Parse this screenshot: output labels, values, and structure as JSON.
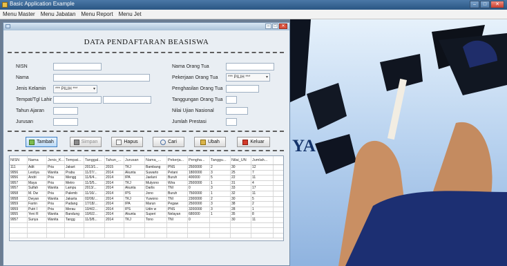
{
  "window": {
    "title": "Basic Application Example"
  },
  "menu": [
    "Menu Master",
    "Menu Jabatan",
    "Menu Report",
    "Menu Jet"
  ],
  "page": {
    "title": "DATA PENDAFTARAN BEASISWA"
  },
  "form": {
    "nisn_label": "NISN",
    "nama_label": "Nama",
    "jk_label": "Jenis Kelamin",
    "jk_value": "*** PILIH ***",
    "ttl_label": "Tempat/Tgl Lahir",
    "tahun_label": "Tahun Ajaran",
    "jurusan_label": "Jurusan",
    "nama_ortu_label": "Nama Orang Tua",
    "pekerjaan_label": "Pekerjaan Orang Tua",
    "pekerjaan_value": "*** PILIH ***",
    "penghasilan_label": "Penghasilan Orang Tua",
    "tanggungan_label": "Tanggungan Orang Tua",
    "nilai_label": "Nilai Ujian Nasional",
    "prestasi_label": "Jumlah Prestasi"
  },
  "buttons": {
    "tambah": "Tambah",
    "simpan": "Simpan",
    "hapus": "Hapus",
    "cari": "Cari",
    "ubah": "Ubah",
    "keluar": "Keluar"
  },
  "table": {
    "headers": [
      "NISN",
      "Nama",
      "Jenis_K...",
      "Tempat...",
      "Tanggal...",
      "Tahun_...",
      "Jurusan",
      "Nama_...",
      "Pekerja...",
      "Pengha...",
      "Tanggu...",
      "Nilai_UN",
      "Jumlah..."
    ],
    "rows": [
      [
        "111",
        "Adit",
        "Pria",
        "Jakart",
        "2013/1...",
        "2015",
        "TKJ",
        "Bambang",
        "PNS",
        "2500000",
        "2",
        "30",
        "12"
      ],
      [
        "9956",
        "Lestiya",
        "Wanita",
        "Prabu",
        "11/27/...",
        "2014",
        "Akunta",
        "Suwarto",
        "Petani",
        "1800000",
        "3",
        "25",
        "7"
      ],
      [
        "9956",
        "Andri",
        "Pria",
        "Mengg",
        "11/6/4...",
        "2014",
        "IPA",
        "Jaelani",
        "Buruh",
        "400000",
        "5",
        "22",
        "11"
      ],
      [
        "9957",
        "Maya",
        "Pria",
        "Metro",
        "11/3/5...",
        "2014",
        "TKJ",
        "Mulyono",
        "Wira",
        "2500000",
        "1",
        "31",
        "4"
      ],
      [
        "9957",
        "Sulfah",
        "Wanita",
        "Lampu",
        "2013/...",
        "2014",
        "Akunta",
        "Darlis",
        "TNI",
        "0",
        "3",
        "33",
        "17"
      ],
      [
        "9958",
        "M. Dw",
        "Pria",
        "Palemb",
        "11/16/...",
        "2014",
        "IPS",
        "Jono",
        "Buruh",
        "7500000",
        "1",
        "32",
        "11"
      ],
      [
        "9958",
        "Dwyan",
        "Wanita",
        "Jakarta",
        "02/06/...",
        "2014",
        "TKJ",
        "Yuwono",
        "TNI",
        "2300000",
        "2",
        "30",
        "5"
      ],
      [
        "9959",
        "Farrin",
        "Pria",
        "Padang",
        "17/18/...",
        "2014",
        "IPA",
        "Marun",
        "Pegaw",
        "2500000",
        "3",
        "38",
        "2"
      ],
      [
        "9959",
        "Putri I",
        "Pria",
        "Merau",
        "10/4/2...",
        "2014",
        "IPS",
        "Udin w",
        "PNS",
        "3200000",
        "3",
        "28",
        "1"
      ],
      [
        "9955",
        "Yeni R",
        "Wanita",
        "Bandung",
        "10/6/2...",
        "2014",
        "Akunta",
        "Superi",
        "Nelayan",
        "680000",
        "1",
        "35",
        "8"
      ],
      [
        "9957",
        "Sunya",
        "Wanita",
        "Tangg",
        "11/3/8...",
        "2014",
        "TKJ",
        "Tono",
        "TNI",
        "0",
        "",
        "30",
        "11"
      ],
      [
        "",
        "",
        "",
        "",
        "",
        "",
        "",
        "",
        "",
        "",
        "",
        "",
        ""
      ],
      [
        "",
        "",
        "",
        "",
        "",
        "",
        "",
        "",
        "",
        "",
        "",
        "",
        ""
      ],
      [
        "",
        "",
        "",
        "",
        "",
        "",
        "",
        "",
        "",
        "",
        "",
        "",
        ""
      ]
    ]
  },
  "background": {
    "letter": "YA"
  }
}
